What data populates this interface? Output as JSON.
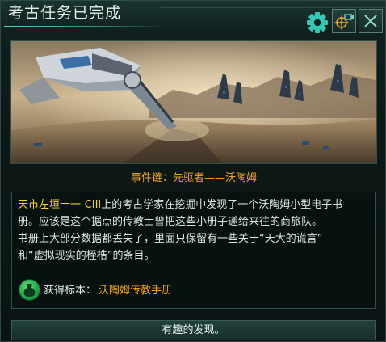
{
  "window": {
    "title": "考古任务已完成"
  },
  "toolbar": {
    "settings_icon": "gear-icon",
    "locate_icon": "crosshair-icon",
    "close_icon": "close-icon"
  },
  "event": {
    "chain_text": "事件链：先驱者——沃陶姆"
  },
  "description": {
    "line1_highlight": "天市左垣十一-CIII",
    "line1_rest": "上的考古学家在挖掘中发现了一个沃陶姆小型电子书",
    "line2": "册。应该是这个据点的传教士曾把这些小册子递给来往的商旅队。",
    "line3": "书册上大部分数据都丢失了，里面只保留有一些关于“天大的谎言”",
    "line4": "和“虚拟现实的桎梏”的条目。"
  },
  "reward": {
    "label": "获得标本：",
    "value": "沃陶姆传教手册",
    "icon": "specimen-icon"
  },
  "option": {
    "label": "有趣的发现。"
  },
  "colors": {
    "accent": "#4fd3c3",
    "highlight_yellow": "#f4d430",
    "orange": "#f0a423",
    "panel_bg": "#0c1817"
  }
}
